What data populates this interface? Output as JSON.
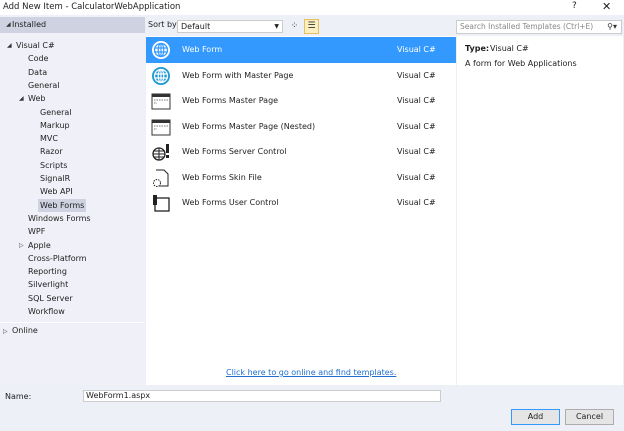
{
  "window": {
    "title": "Add New Item - CalculatorWebApplication",
    "help": "?",
    "close": "✕"
  },
  "sidebar": {
    "installed": "Installed",
    "online": "Online",
    "items": [
      {
        "label": "Visual C#",
        "depth": 0,
        "expander": "expanded"
      },
      {
        "label": "Code",
        "depth": 1
      },
      {
        "label": "Data",
        "depth": 1
      },
      {
        "label": "General",
        "depth": 1
      },
      {
        "label": "Web",
        "depth": 1,
        "expander": "expanded"
      },
      {
        "label": "General",
        "depth": 2
      },
      {
        "label": "Markup",
        "depth": 2
      },
      {
        "label": "MVC",
        "depth": 2
      },
      {
        "label": "Razor",
        "depth": 2
      },
      {
        "label": "Scripts",
        "depth": 2
      },
      {
        "label": "SignalR",
        "depth": 2
      },
      {
        "label": "Web API",
        "depth": 2
      },
      {
        "label": "Web Forms",
        "depth": 2,
        "selected": true
      },
      {
        "label": "Windows Forms",
        "depth": 1
      },
      {
        "label": "WPF",
        "depth": 1
      },
      {
        "label": "Apple",
        "depth": 1,
        "expander": "collapsed"
      },
      {
        "label": "Cross-Platform",
        "depth": 1
      },
      {
        "label": "Reporting",
        "depth": 1
      },
      {
        "label": "Silverlight",
        "depth": 1
      },
      {
        "label": "SQL Server",
        "depth": 1
      },
      {
        "label": "Workflow",
        "depth": 1
      }
    ]
  },
  "toolbar": {
    "sort_label": "Sort by:",
    "sort_value": "Default",
    "search_placeholder": "Search Installed Templates (Ctrl+E)"
  },
  "templates": [
    {
      "name": "Web Form",
      "type": "Visual C#",
      "icon": "globe-icon",
      "selected": true
    },
    {
      "name": "Web Form with Master Page",
      "type": "Visual C#",
      "icon": "globe-icon"
    },
    {
      "name": "Web Forms Master Page",
      "type": "Visual C#",
      "icon": "master-page-icon"
    },
    {
      "name": "Web Forms Master Page (Nested)",
      "type": "Visual C#",
      "icon": "master-page-icon"
    },
    {
      "name": "Web Forms Server Control",
      "type": "Visual C#",
      "icon": "server-control-icon"
    },
    {
      "name": "Web Forms Skin File",
      "type": "Visual C#",
      "icon": "skin-file-icon"
    },
    {
      "name": "Web Forms User Control",
      "type": "Visual C#",
      "icon": "user-control-icon"
    }
  ],
  "online_link": "Click here to go online and find templates.",
  "details": {
    "type_label": "Type:",
    "type_value": "Visual C#",
    "description": "A form for Web Applications"
  },
  "footer": {
    "name_label": "Name:",
    "name_value": "WebForm1.aspx",
    "add": "Add",
    "cancel": "Cancel"
  },
  "colors": {
    "selection": "#3399ff",
    "link": "#1e6fd0"
  }
}
